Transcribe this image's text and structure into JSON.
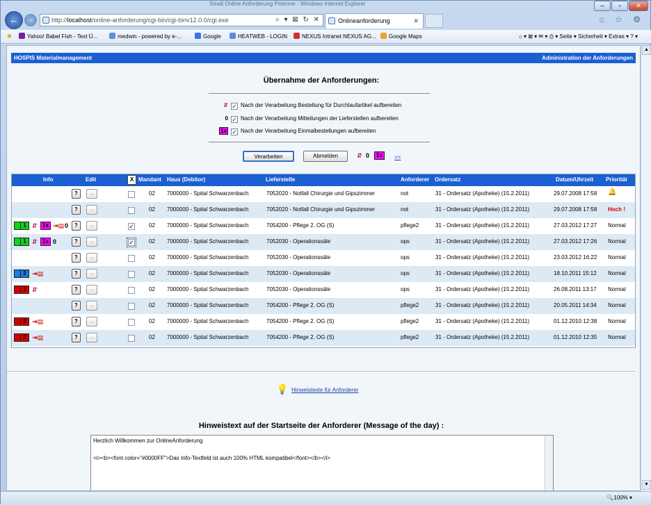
{
  "browser": {
    "title_text": "Small Online Anforderung Peterme - Windows Internet Explorer",
    "url_prefix": "http://",
    "url_host": "localhost",
    "url_path": "/online-anforderung/cgi-bin/cgi-binv12.0.0/cgi.exe",
    "addr_tools": "⌕ ▾ ⊠ ↻ ✕",
    "tab_title": "Onlineanforderung",
    "tab_close": "✕",
    "right_tools": "⌂ ☆ ⚙",
    "back": "←",
    "fwd": "→",
    "win_min": "–",
    "win_max": "▫",
    "win_close": "✕",
    "favorites": [
      {
        "label": "Yahoo! Babel Fish - Text Ü...",
        "color": "#7b1fa2"
      },
      {
        "label": "medwin - powered by e-...",
        "color": "#5b8fd6"
      },
      {
        "label": "Google",
        "color": "#3a78d9"
      },
      {
        "label": "HEATWEB - LOGIN",
        "color": "#5b8fd6"
      },
      {
        "label": "NEXUS Intranet NEXUS AG...",
        "color": "#d32f2f"
      },
      {
        "label": "Google Maps",
        "color": "#f0a030"
      }
    ],
    "fav_right": "⌂ ▾  ⊠ ▾  ✉ ▾  ⎙ ▾  Seite ▾  Sicherheit ▾  Extras ▾  ? ▾",
    "zoom": "🔍100%  ▾"
  },
  "header": {
    "left": "HOSPIS Materialmanagement",
    "right": "Administration der Anforderungen"
  },
  "heading": "Übernahme der Anforderungen:",
  "options": [
    {
      "icon": "⇵",
      "icon_color": "#c2185b",
      "label": "Nach der Verarbeitung Bestellung für Durchlaufartikel aufbereiten",
      "checked": "✓"
    },
    {
      "icon": "0",
      "icon_color": "#000000",
      "label": "Nach der Verarbeitung Mitteilungen der Lieferstellen aufbereiten",
      "checked": "✓"
    },
    {
      "icon": "1x",
      "icon_color": "#ff00ff",
      "label": "Nach der Verarbeitung Einmalbestellungen aufbereiten",
      "checked": "✓"
    }
  ],
  "buttons": {
    "process": "Verarbeiten",
    "logout": "Abmelden",
    "more": ">>",
    "legend_1": "⇵",
    "legend_2": "0",
    "legend_3": "1x"
  },
  "table": {
    "headers": {
      "info": "Info",
      "edit": "Edit",
      "x": "X",
      "mandant": "Mandant",
      "haus": "Haus (Debitor)",
      "lieferstelle": "Lieferstelle",
      "anforderer": "Anforderer",
      "ordersatz": "Ordersatz",
      "datum": "Datum/Uhrzeit",
      "prioritat": "Priorität"
    },
    "q_label": "?",
    "e_label": "...",
    "rows": [
      {
        "mandant": "02",
        "haus": "7000000 - Spital Schwarzenbach",
        "lieferstelle": "7052020 - Notfall Chirurgie und Gipszimmer",
        "anforderer": "not",
        "ordersatz": "31 - Ordersatz (Apotheke) (15.2.2011)",
        "datum": "29.07.2008 17:58",
        "prio": "🔔",
        "checked": "",
        "info": []
      },
      {
        "mandant": "02",
        "haus": "7000000 - Spital Schwarzenbach",
        "lieferstelle": "7052020 - Notfall Chirurgie und Gipszimmer",
        "anforderer": "not",
        "ordersatz": "31 - Ordersatz (Apotheke) (15.2.2011)",
        "datum": "29.07.2008 17:58",
        "prio": "Hoch !",
        "checked": "",
        "info": []
      },
      {
        "mandant": "02",
        "haus": "7000000 - Spital Schwarzenbach",
        "lieferstelle": "7054200 - Pflege 2. OG (S)",
        "anforderer": "pflege2",
        "ordersatz": "31 - Ordersatz (Apotheke) (15.2.2011)",
        "datum": "27.03.2012 17:27",
        "prio": "Normal",
        "checked": "✓",
        "info": [
          "green-1",
          "hash",
          "1x",
          "doc",
          "zero"
        ]
      },
      {
        "mandant": "02",
        "haus": "7000000 - Spital Schwarzenbach",
        "lieferstelle": "7052030 - Operationssäle",
        "anforderer": "ops",
        "ordersatz": "31 - Ordersatz (Apotheke) (15.2.2011)",
        "datum": "27.03.2012 17:26",
        "prio": "Normal",
        "checked": "✓",
        "info": [
          "green-1",
          "hash",
          "1x",
          "zero"
        ]
      },
      {
        "mandant": "02",
        "haus": "7000000 - Spital Schwarzenbach",
        "lieferstelle": "7052030 - Operationssäle",
        "anforderer": "ops",
        "ordersatz": "31 - Ordersatz (Apotheke) (15.2.2011)",
        "datum": "23.03.2012 16:22",
        "prio": "Normal",
        "checked": "",
        "info": []
      },
      {
        "mandant": "02",
        "haus": "7000000 - Spital Schwarzenbach",
        "lieferstelle": "7052030 - Operationssäle",
        "anforderer": "ops",
        "ordersatz": "31 - Ordersatz (Apotheke) (15.2.2011)",
        "datum": "18.10.2011 15:12",
        "prio": "Normal",
        "checked": "",
        "info": [
          "blue-2",
          "doc"
        ]
      },
      {
        "mandant": "02",
        "haus": "7000000 - Spital Schwarzenbach",
        "lieferstelle": "7052030 - Operationssäle",
        "anforderer": "ops",
        "ordersatz": "31 - Ordersatz (Apotheke) (15.2.2011)",
        "datum": "26.08.2011 13:17",
        "prio": "Normal",
        "checked": "",
        "info": [
          "red-1",
          "hash"
        ]
      },
      {
        "mandant": "02",
        "haus": "7000000 - Spital Schwarzenbach",
        "lieferstelle": "7054200 - Pflege 2. OG (S)",
        "anforderer": "pflege2",
        "ordersatz": "31 - Ordersatz (Apotheke) (15.2.2011)",
        "datum": "20.05.2011 14:34",
        "prio": "Normal",
        "checked": "",
        "info": []
      },
      {
        "mandant": "02",
        "haus": "7000000 - Spital Schwarzenbach",
        "lieferstelle": "7054200 - Pflege 2. OG (S)",
        "anforderer": "pflege2",
        "ordersatz": "31 - Ordersatz (Apotheke) (15.2.2011)",
        "datum": "01.12.2010 12:38",
        "prio": "Normal",
        "checked": "",
        "info": [
          "red-2",
          "doc"
        ]
      },
      {
        "mandant": "02",
        "haus": "7000000 - Spital Schwarzenbach",
        "lieferstelle": "7054200 - Pflege 2. OG (S)",
        "anforderer": "pflege2",
        "ordersatz": "31 - Ordersatz (Apotheke) (15.2.2011)",
        "datum": "01.12.2010 12:35",
        "prio": "Normal",
        "checked": "",
        "info": [
          "red-2",
          "doc"
        ]
      }
    ]
  },
  "hint_link": "Hinweistexte für Anforderer",
  "motd": {
    "title": "Hinweistext auf der Startseite der Anforderer (Message of the day) :",
    "line1": "Herzlich Willkommen zur OnlineAnforderung",
    "line2": "<i><b><font color=\"#0000FF\">Das Info-Textfeld ist auch 100% HTML kompatibel</font></b></i>"
  }
}
